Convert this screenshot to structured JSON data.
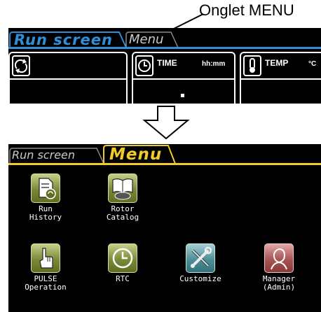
{
  "callout": {
    "label": "Onglet MENU"
  },
  "run_screen_view": {
    "tabs": [
      {
        "label": "Run screen",
        "active": true
      },
      {
        "label": "Menu",
        "active": false
      }
    ],
    "cards": [
      {
        "label": "",
        "unit": "",
        "icon": "rotate-icon"
      },
      {
        "label": "TIME",
        "unit": "hh:mm",
        "icon": "clock-icon"
      },
      {
        "label": "TEMP",
        "unit": "°C",
        "icon": "thermometer-icon"
      }
    ]
  },
  "menu_view": {
    "tabs": [
      {
        "label": "Run screen",
        "active": false
      },
      {
        "label": "Menu",
        "active": true
      }
    ],
    "items": [
      {
        "label": "Run\nHistory",
        "icon": "run-history-icon"
      },
      {
        "label": "Rotor\nCatalog",
        "icon": "rotor-catalog-icon"
      },
      {
        "label": "PULSE\nOperation",
        "icon": "pulse-operation-icon"
      },
      {
        "label": "RTC",
        "icon": "clock-icon"
      },
      {
        "label": "Customize",
        "icon": "tools-icon"
      },
      {
        "label": "Manager\n(Admin)",
        "icon": "manager-icon"
      }
    ]
  },
  "colors": {
    "run_tab_accent": "#2e8fd8",
    "menu_tab_accent": "#f2ca2c",
    "screen_bg": "#000000"
  }
}
